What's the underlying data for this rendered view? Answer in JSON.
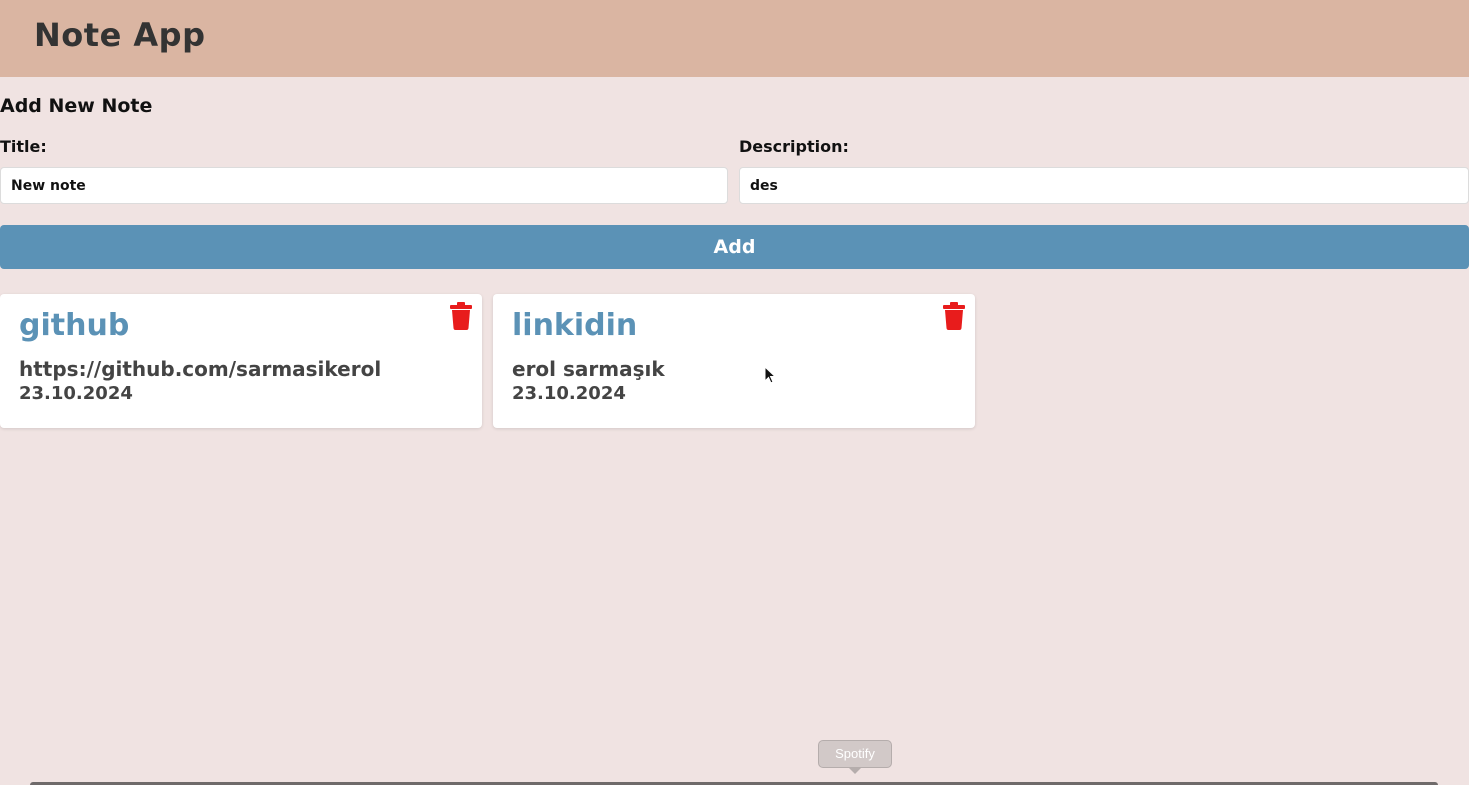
{
  "header": {
    "title": "Note App"
  },
  "form": {
    "heading": "Add New Note",
    "title_label": "Title:",
    "title_value": "New note",
    "description_label": "Description:",
    "description_value": "des",
    "add_label": "Add"
  },
  "notes": [
    {
      "title": "github",
      "description": "https://github.com/sarmasikerol",
      "date": "23.10.2024"
    },
    {
      "title": "linkidin",
      "description": "erol sarmaşık",
      "date": "23.10.2024"
    }
  ],
  "dock": {
    "tooltip": "Spotify"
  },
  "colors": {
    "header_bg": "#dab5a2",
    "page_bg": "#f0e3e2",
    "accent": "#5b92b6",
    "delete": "#e81c1c"
  },
  "icons": {
    "delete": "trash-icon",
    "cursor": "mouse-pointer-icon"
  }
}
